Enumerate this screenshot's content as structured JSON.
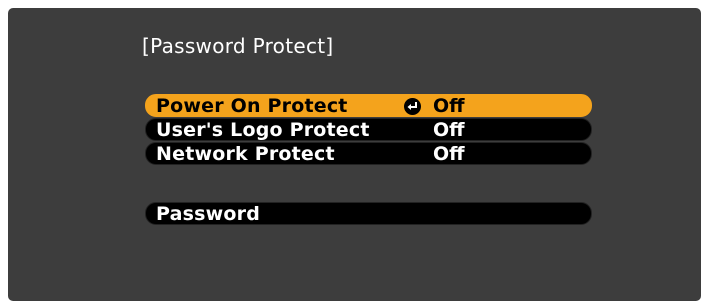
{
  "menu": {
    "title": "[Password Protect]",
    "items": [
      {
        "label": "Power On Protect",
        "value": "Off",
        "selected": true
      },
      {
        "label": "User's Logo Protect",
        "value": "Off",
        "selected": false
      },
      {
        "label": "Network Protect",
        "value": "Off",
        "selected": false
      }
    ],
    "password": {
      "label": "Password"
    }
  },
  "icons": {
    "enter": "enter-return-icon"
  },
  "colors": {
    "screen_background": "#3d3d3d",
    "row_background": "#000000",
    "selected_highlight": "#f4a31c",
    "text": "#ffffff"
  }
}
